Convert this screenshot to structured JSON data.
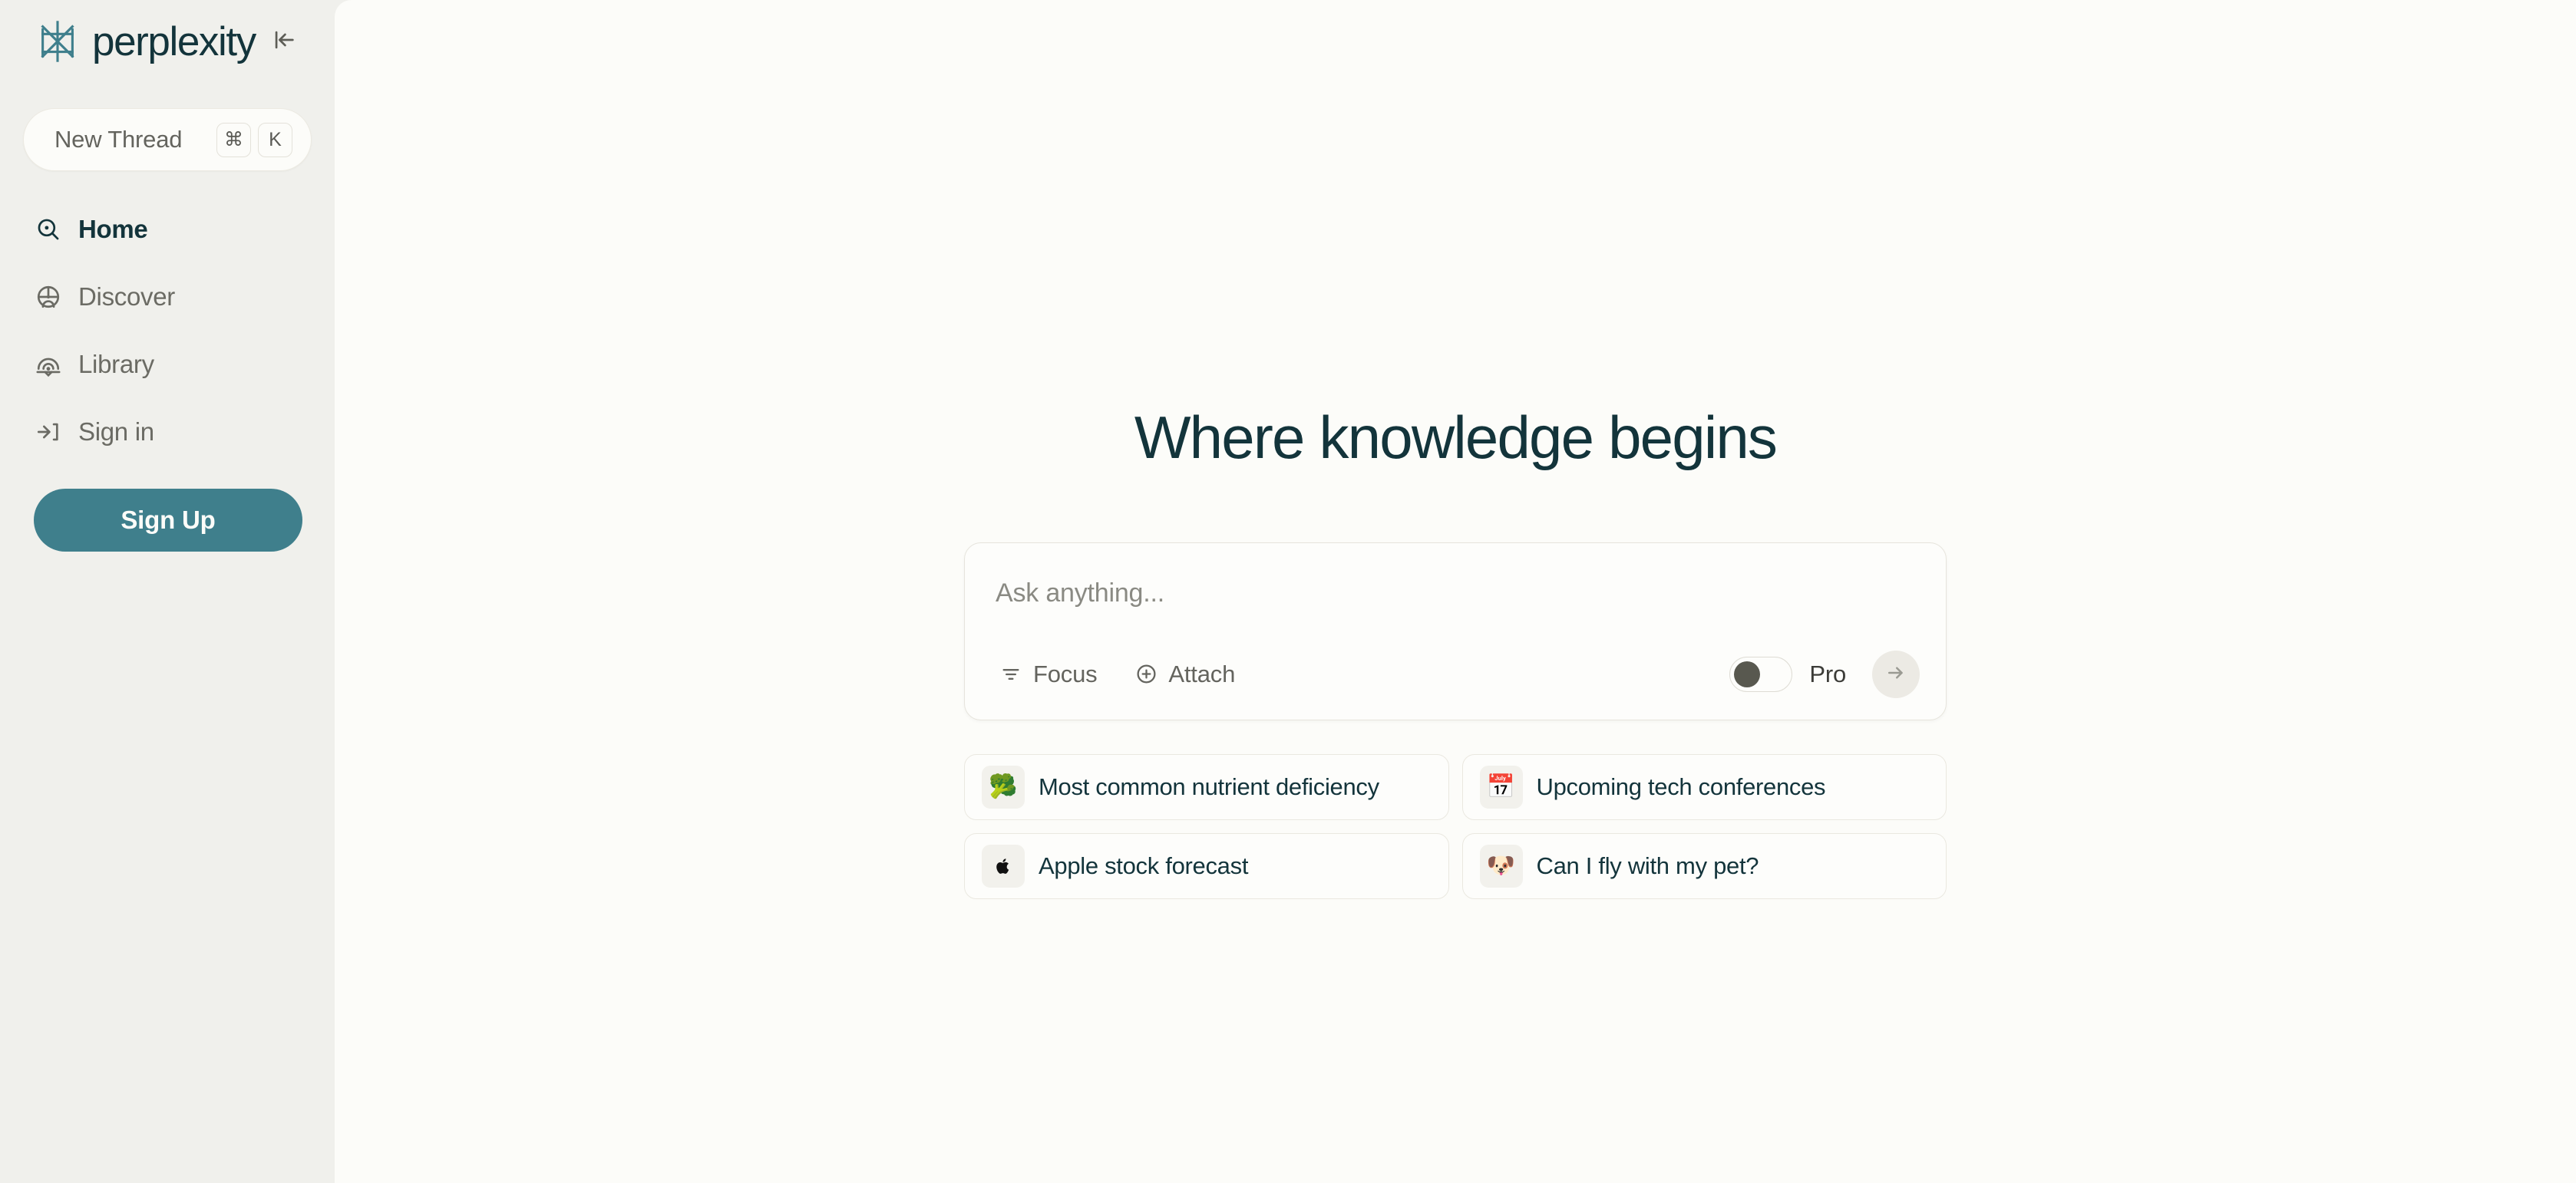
{
  "brand": {
    "name": "perplexity",
    "logo_icon": "perplexity-logo-mark",
    "logo_color": "#3f7f8c",
    "collapse_icon": "collapse-sidebar-icon"
  },
  "sidebar": {
    "new_thread": {
      "label": "New Thread",
      "shortcut_keys": [
        "⌘",
        "K"
      ]
    },
    "nav_items": [
      {
        "label": "Home",
        "icon": "search-home-icon",
        "active": true
      },
      {
        "label": "Discover",
        "icon": "globe-icon",
        "active": false
      },
      {
        "label": "Library",
        "icon": "library-arch-icon",
        "active": false
      },
      {
        "label": "Sign in",
        "icon": "sign-in-arrow-icon",
        "active": false
      }
    ],
    "signup_button": {
      "label": "Sign Up",
      "color": "#3f7f8c"
    }
  },
  "main": {
    "headline": "Where knowledge begins",
    "ask_box": {
      "placeholder": "Ask anything...",
      "value": "",
      "focus_button": {
        "label": "Focus",
        "icon": "focus-filter-icon"
      },
      "attach_button": {
        "label": "Attach",
        "icon": "plus-circle-icon"
      },
      "pro_toggle": {
        "label": "Pro",
        "enabled": false
      },
      "submit_button": {
        "icon": "arrow-right-icon"
      }
    },
    "suggestions": [
      {
        "emoji": "🥦",
        "emoji_name": "broccoli-emoji",
        "label": "Most common nutrient deficiency"
      },
      {
        "emoji": "📅",
        "emoji_name": "calendar-emoji",
        "label": "Upcoming tech conferences"
      },
      {
        "emoji": "",
        "emoji_name": "apple-logo-icon",
        "label": "Apple stock forecast"
      },
      {
        "emoji": "🐶",
        "emoji_name": "dog-face-emoji",
        "label": "Can I fly with my pet?"
      }
    ]
  },
  "colors": {
    "sidebar_bg": "#f0f0ec",
    "main_bg": "#fcfcf9",
    "accent": "#3f7f8c",
    "text_dark": "#13343b",
    "text_muted": "#6b6b64"
  }
}
